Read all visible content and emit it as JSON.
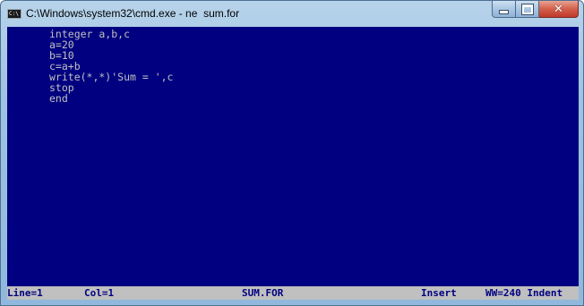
{
  "window": {
    "title": "C:\\Windows\\system32\\cmd.exe - ne  sum.for",
    "icon": "console-app-icon",
    "icon_text": "C:\\",
    "controls": {
      "minimize": "minimize-icon",
      "maximize": "maximize-icon",
      "close_glyph": "✕"
    }
  },
  "editor": {
    "lines": [
      "integer a,b,c",
      "a=20",
      "b=10",
      "c=a+b",
      "write(*,*)'Sum = ',c",
      "stop",
      "end"
    ]
  },
  "status": {
    "line": "Line=1",
    "col": "Col=1",
    "file": "SUM.FOR",
    "mode": "Insert",
    "ww": "WW=240 Indent"
  },
  "colors": {
    "console_bg": "#000080",
    "console_fg": "#c0c0c0",
    "status_bg": "#c0c0c0",
    "status_fg": "#000080",
    "close_button": "#c0392b"
  }
}
